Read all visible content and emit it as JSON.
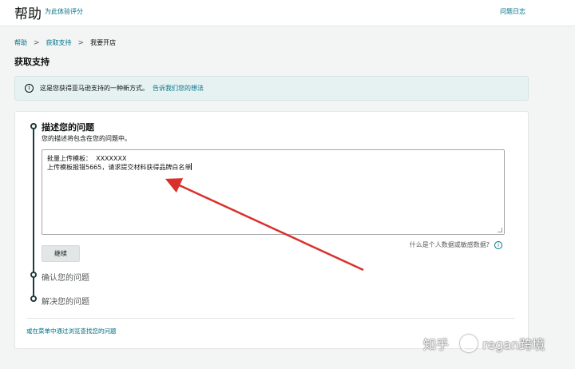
{
  "header": {
    "title": "帮助",
    "subtitle": "为此体验评分",
    "log_link": "问题日志"
  },
  "breadcrumb": {
    "items": [
      "帮助",
      "获取支持",
      "我要开店"
    ],
    "separator": ">"
  },
  "page": {
    "title": "获取支持"
  },
  "info": {
    "icon": "info-icon",
    "text": "这是您获得亚马逊支持的一种新方式。",
    "link": "告诉我们您的想法"
  },
  "steps": {
    "step1": {
      "title": "描述您的问题",
      "description": "您的描述将包含在您的问题中。",
      "textarea_lines": [
        "批量上传模板：  XXXXXXX",
        "上传模板报错5665，请求提交材料获得品牌白名单"
      ],
      "privacy_text": "什么是个人数据或敏感数据?",
      "continue_label": "继续"
    },
    "step2": {
      "title": "确认您的问题"
    },
    "step3": {
      "title": "解决您的问题"
    }
  },
  "footer": {
    "link": "或在菜单中通过浏览查找您的问题"
  },
  "watermark": {
    "text_left": "知乎",
    "text_right": "regan跨境"
  },
  "colors": {
    "link": "#007185",
    "timeline": "#1d3a3a",
    "info_bg": "#e6f2f2",
    "annotation_arrow": "#d9302c"
  }
}
